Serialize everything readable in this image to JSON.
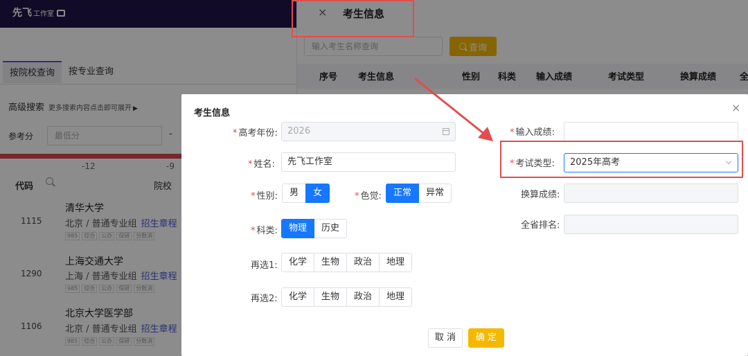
{
  "background": {
    "logo": {
      "main": "先飞",
      "sub": "工作室"
    },
    "tabs": [
      "按院校查询",
      "按专业查询"
    ],
    "advanced": {
      "label": "高级搜索",
      "hint": "更多搜索内容点击即可展开"
    },
    "score": {
      "label": "参考分",
      "placeholder": "最低分",
      "dash": "-"
    },
    "scale_ticks": [
      "-12",
      "-9"
    ],
    "table_headers": {
      "code": "代码",
      "school": "院校"
    },
    "rows": [
      {
        "code": "1115",
        "name": "清华大学",
        "sub": "北京 / 普通专业组",
        "link": "招生章程",
        "tags": [
          "985",
          "综合",
          "公办",
          "保研",
          "分数消"
        ]
      },
      {
        "code": "1290",
        "name": "上海交通大学",
        "sub": "上海 / 普通专业组",
        "link": "招生章程",
        "tags": [
          "985",
          "综合",
          "公办",
          "保研",
          "分数消"
        ]
      },
      {
        "code": "1106",
        "name": "北京大学医学部",
        "sub": "北京 / 普通专业组",
        "link": "招生章程",
        "tags": [
          "985",
          "综合",
          "公办",
          "保研",
          "分数消"
        ]
      }
    ],
    "drawer": {
      "close": "×",
      "title": "考生信息",
      "search_placeholder": "输入考生名称查询",
      "search_button": "查询",
      "columns": [
        "序号",
        "考生信息",
        "性别",
        "科类",
        "输入成绩",
        "考试类型",
        "换算成绩",
        "全"
      ]
    }
  },
  "modal": {
    "title": "考生信息",
    "close": "×",
    "fields": {
      "year": {
        "label": "高考年份:",
        "value": "2026"
      },
      "name": {
        "label": "姓名:",
        "value": "先飞工作室"
      },
      "gender": {
        "label": "性别:",
        "options": [
          "男",
          "女"
        ],
        "selected": "女"
      },
      "color_vision": {
        "label": "色觉:",
        "options": [
          "正常",
          "异常"
        ],
        "selected": "正常"
      },
      "subject": {
        "label": "科类:",
        "options": [
          "物理",
          "历史"
        ],
        "selected": "物理"
      },
      "elective1": {
        "label": "再选1:",
        "options": [
          "化学",
          "生物",
          "政治",
          "地理"
        ]
      },
      "elective2": {
        "label": "再选2:",
        "options": [
          "化学",
          "生物",
          "政治",
          "地理"
        ]
      },
      "score": {
        "label": "输入成绩:",
        "value": ""
      },
      "exam_type": {
        "label": "考试类型:",
        "value": "2025年高考"
      },
      "converted": {
        "label": "换算成绩:",
        "value": ""
      },
      "rank": {
        "label": "全省排名:",
        "value": ""
      }
    },
    "buttons": {
      "cancel": "取 消",
      "ok": "确 定"
    }
  },
  "colors": {
    "primary": "#1677ff",
    "accent": "#f5b800",
    "annotation": "#e24d4d",
    "topbar": "#1f1548"
  }
}
